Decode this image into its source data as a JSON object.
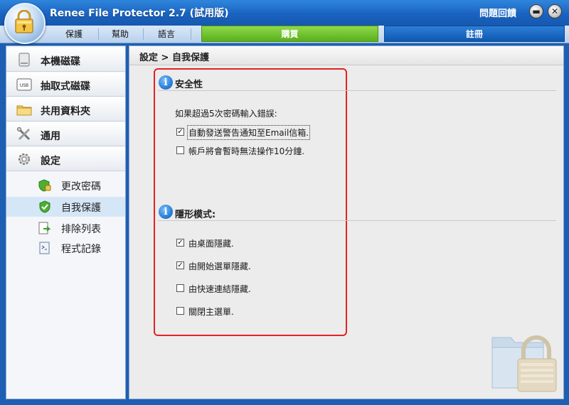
{
  "window": {
    "title": "Renee File Protector 2.7 (試用版)",
    "feedback_label": "問題回饋",
    "minimize_symbol": "▬",
    "close_symbol": "✕"
  },
  "menubar": {
    "items": [
      {
        "label": "保護"
      },
      {
        "label": "幫助"
      },
      {
        "label": "語言"
      }
    ],
    "buy_label": "購買",
    "register_label": "註冊"
  },
  "sidebar": {
    "items": [
      {
        "label": "本機磁碟",
        "icon": "hard-drive-icon"
      },
      {
        "label": "抽取式磁碟",
        "icon": "usb-drive-icon"
      },
      {
        "label": "共用資料夾",
        "icon": "shared-folder-icon"
      },
      {
        "label": "通用",
        "icon": "tools-icon"
      },
      {
        "label": "設定",
        "icon": "gear-icon"
      }
    ],
    "sub_items": [
      {
        "label": "更改密碼",
        "icon": "shield-lock-icon"
      },
      {
        "label": "自我保護",
        "icon": "shield-check-icon",
        "active": true
      },
      {
        "label": "排除列表",
        "icon": "exclude-list-icon"
      },
      {
        "label": "程式記錄",
        "icon": "log-icon"
      }
    ]
  },
  "main": {
    "breadcrumb": "設定 > 自我保護",
    "security": {
      "heading": "安全性",
      "prompt": "如果超過5次密碼輸入錯誤:",
      "options": [
        {
          "label": "自動發送警告通知至Email信箱.",
          "checked": true
        },
        {
          "label": "帳戶將會暫時無法操作10分鐘.",
          "checked": false
        }
      ]
    },
    "stealth": {
      "heading": "隱形模式:",
      "options": [
        {
          "label": "由桌面隱藏.",
          "checked": true
        },
        {
          "label": "由開始選單隱藏.",
          "checked": true
        },
        {
          "label": "由快速連結隱藏.",
          "checked": false
        },
        {
          "label": "關閉主選單.",
          "checked": false
        }
      ]
    },
    "check_mark": "✓",
    "info_glyph": "i"
  },
  "colors": {
    "titlebar": "#1a63c0",
    "buy": "#5aae1c",
    "register": "#0f57b0",
    "highlight_box": "#e32222"
  }
}
